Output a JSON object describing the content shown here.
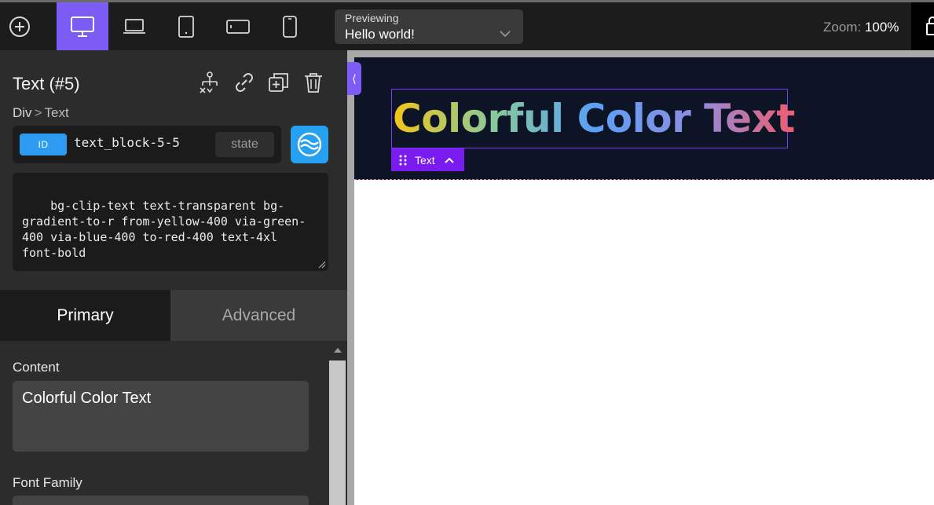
{
  "toolbar": {
    "preview_label": "Previewing",
    "preview_value": "Hello world!",
    "zoom_label": "Zoom:",
    "zoom_value": "100%",
    "accent": "#7c5cf5",
    "devices": [
      "desktop-icon",
      "laptop-icon",
      "tablet-icon",
      "tablet-landscape-icon",
      "mobile-icon"
    ],
    "active_device": "desktop"
  },
  "panel": {
    "title": "Text (#5)",
    "breadcrumb": [
      "Div",
      "Text"
    ],
    "breadcrumb_sep": ">",
    "id_badge": "ID",
    "id_value": "text_block-5-5",
    "state_label": "state",
    "classes": "bg-clip-text text-transparent bg-gradient-to-r from-yellow-400 via-green-400 via-blue-400 to-red-400 text-4xl font-bold",
    "tabs": [
      {
        "label": "Primary",
        "active": true
      },
      {
        "label": "Advanced",
        "active": false
      }
    ],
    "fields": {
      "content_label": "Content",
      "content_value": "Colorful Color Text",
      "font_family_label": "Font Family"
    }
  },
  "canvas": {
    "heading_text": "Colorful Color Text",
    "selection_tag": "Text",
    "collapse_glyph": "⟨"
  }
}
